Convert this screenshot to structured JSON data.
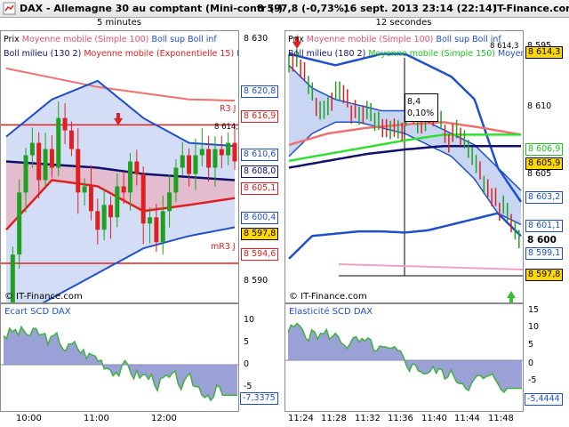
{
  "title_bar": {
    "instrument": "DAX - Allemagne 30 au comptant (Mini-contr (-)",
    "price_change": "8 597,8 (-0,73%)",
    "datetime": "16 sept. 2013 23:14 (22:14)",
    "brand": "IT-Finance.com"
  },
  "left_panel": {
    "header": "5 minutes",
    "legend_row1": [
      "Prix",
      "Moyenne mobile (Simple 100)",
      "Boll sup",
      "Boll inf"
    ],
    "legend_row2": [
      "Boll milieu (130 2)",
      "Moyenne mobile (Exponentielle 15)",
      "M"
    ],
    "copyright": "© IT-Finance.com",
    "r3_label": "R3 J",
    "mr3_label": "mR3 J",
    "last_tick": "8 614,3",
    "y_ticks": [
      "8 630",
      "8 590"
    ],
    "price_tags": [
      {
        "value": "8 620,8",
        "color": "#2050c8",
        "bg": "#ffffff"
      },
      {
        "value": "8 616,9",
        "color": "#e02020",
        "bg": "#ffffff"
      },
      {
        "value": "8 610,6",
        "color": "#2050c8",
        "bg": "#ffffff"
      },
      {
        "value": "8 608,0",
        "color": "#101070",
        "bg": "#ffffff"
      },
      {
        "value": "8 605,1",
        "color": "#e02020",
        "bg": "#ffffff"
      },
      {
        "value": "8 600,4",
        "color": "#2050c8",
        "bg": "#ffffff"
      },
      {
        "value": "8 597,8",
        "color": "#000000",
        "bg": "#ffd700"
      },
      {
        "value": "8 594,6",
        "color": "#e02020",
        "bg": "#ffffff"
      }
    ],
    "indicator": {
      "title": "Ecart SCD DAX",
      "y_ticks": [
        "10",
        "5",
        "0",
        "-5"
      ],
      "last_value": "-7,3375"
    },
    "x_labels": [
      "10:00",
      "11:00",
      "12:00"
    ]
  },
  "right_panel": {
    "header": "12 secondes",
    "legend_row1": [
      "Prix",
      "Moyenne mobile (Simple 100)",
      "Boll sup",
      "Boll inf"
    ],
    "legend_row2": [
      "Boll milieu (180 2)",
      "Moyenne mobile (Simple 150)",
      "Moyen"
    ],
    "copyright": "© IT-Finance.com",
    "crosshair_box": [
      "8,4",
      "0,10%"
    ],
    "last_tick": "8 614,3",
    "y_ticks": [
      "8 610",
      "8 605",
      "8 600",
      "8 595"
    ],
    "price_tags": [
      {
        "value": "8 614,3",
        "color": "#000000",
        "bg": "#ffd700"
      },
      {
        "value": "8 606,9",
        "color": "#20c020",
        "bg": "#ffffff"
      },
      {
        "value": "8 605,9",
        "color": "#000000",
        "bg": "#ffd700"
      },
      {
        "value": "8 603,2",
        "color": "#2050c8",
        "bg": "#ffffff"
      },
      {
        "value": "8 601,1",
        "color": "#2050c8",
        "bg": "#ffffff"
      },
      {
        "value": "8 599,1",
        "color": "#2050c8",
        "bg": "#ffffff"
      },
      {
        "value": "8 597,8",
        "color": "#000000",
        "bg": "#ffd700"
      }
    ],
    "indicator": {
      "title": "Elasticité SCD DAX",
      "y_ticks": [
        "15",
        "10",
        "5",
        "0",
        "-5"
      ],
      "last_value": "-5,4444"
    },
    "x_labels": [
      "11:24",
      "11:28",
      "11:32",
      "11:36",
      "11:40",
      "11:44",
      "11:48"
    ]
  },
  "colors": {
    "up": "#20a020",
    "down": "#e02020",
    "boll_band": "#2050c8",
    "sma": "#f07070",
    "ema": "#e02020",
    "navy": "#101070",
    "green_ma": "#30e030",
    "indicator_fill": "#8890d0"
  },
  "chart_data": [
    {
      "type": "line",
      "title": "5 minutes",
      "x_ticks": [
        "10:00",
        "11:00",
        "12:00"
      ],
      "ylim": [
        8588,
        8632
      ],
      "series": [
        {
          "name": "Prix",
          "close": [
            8578,
            8596,
            8606,
            8612,
            8614,
            8608,
            8613,
            8610,
            8618,
            8616,
            8613,
            8606,
            8607,
            8603,
            8600,
            8604,
            8602,
            8607,
            8606,
            8611,
            8609,
            8601,
            8602,
            8598,
            8603,
            8606,
            8610,
            8612,
            8609,
            8612,
            8613,
            8610,
            8613,
            8612,
            8614,
            8611
          ]
        },
        {
          "name": "Moyenne mobile (Simple 100)",
          "values": [
            8626,
            8624.5,
            8623,
            8622,
            8621,
            8620.8
          ]
        },
        {
          "name": "Boll sup",
          "values": [
            8615,
            8621,
            8624,
            8618,
            8614,
            8613.5
          ]
        },
        {
          "name": "Boll inf",
          "values": [
            8585,
            8589,
            8593,
            8597,
            8599,
            8600.4
          ]
        },
        {
          "name": "Boll milieu (130 2)",
          "values": [
            8611,
            8610.5,
            8610,
            8609,
            8608.5,
            8608
          ]
        },
        {
          "name": "Moyenne mobile (Exponentielle 15)",
          "values": [
            8600,
            8608,
            8607,
            8603,
            8604,
            8605.1
          ]
        }
      ],
      "levels": {
        "R3 J": 8616.9,
        "mR3 J": 8594.6
      }
    },
    {
      "type": "line",
      "title": "12 secondes",
      "x_ticks": [
        "11:24",
        "11:28",
        "11:32",
        "11:36",
        "11:40",
        "11:44",
        "11:48"
      ],
      "ylim": [
        8592,
        8616
      ],
      "series": [
        {
          "name": "Prix",
          "close": [
            8613,
            8614,
            8612,
            8610,
            8609,
            8610,
            8611,
            8610,
            8609,
            8608,
            8609,
            8608,
            8607,
            8608,
            8607,
            8609,
            8608,
            8608,
            8609,
            8608,
            8606,
            8607,
            8606,
            8605,
            8603,
            8602,
            8601,
            8600,
            8599,
            8598
          ]
        },
        {
          "name": "Moyenne mobile (Simple 100)",
          "values": [
            8606,
            8607,
            8607.5,
            8607.8,
            8608,
            8607.5,
            8606.9
          ]
        },
        {
          "name": "Boll milieu (180 2)",
          "values": [
            8604,
            8604.6,
            8605.2,
            8605.6,
            8605.9,
            8605.9,
            8605.9
          ]
        },
        {
          "name": "Moyenne mobile (Simple 150)",
          "values": [
            8604.6,
            8605.2,
            8605.8,
            8606.4,
            8606.9,
            8606.9,
            8606.9
          ]
        }
      ]
    }
  ]
}
